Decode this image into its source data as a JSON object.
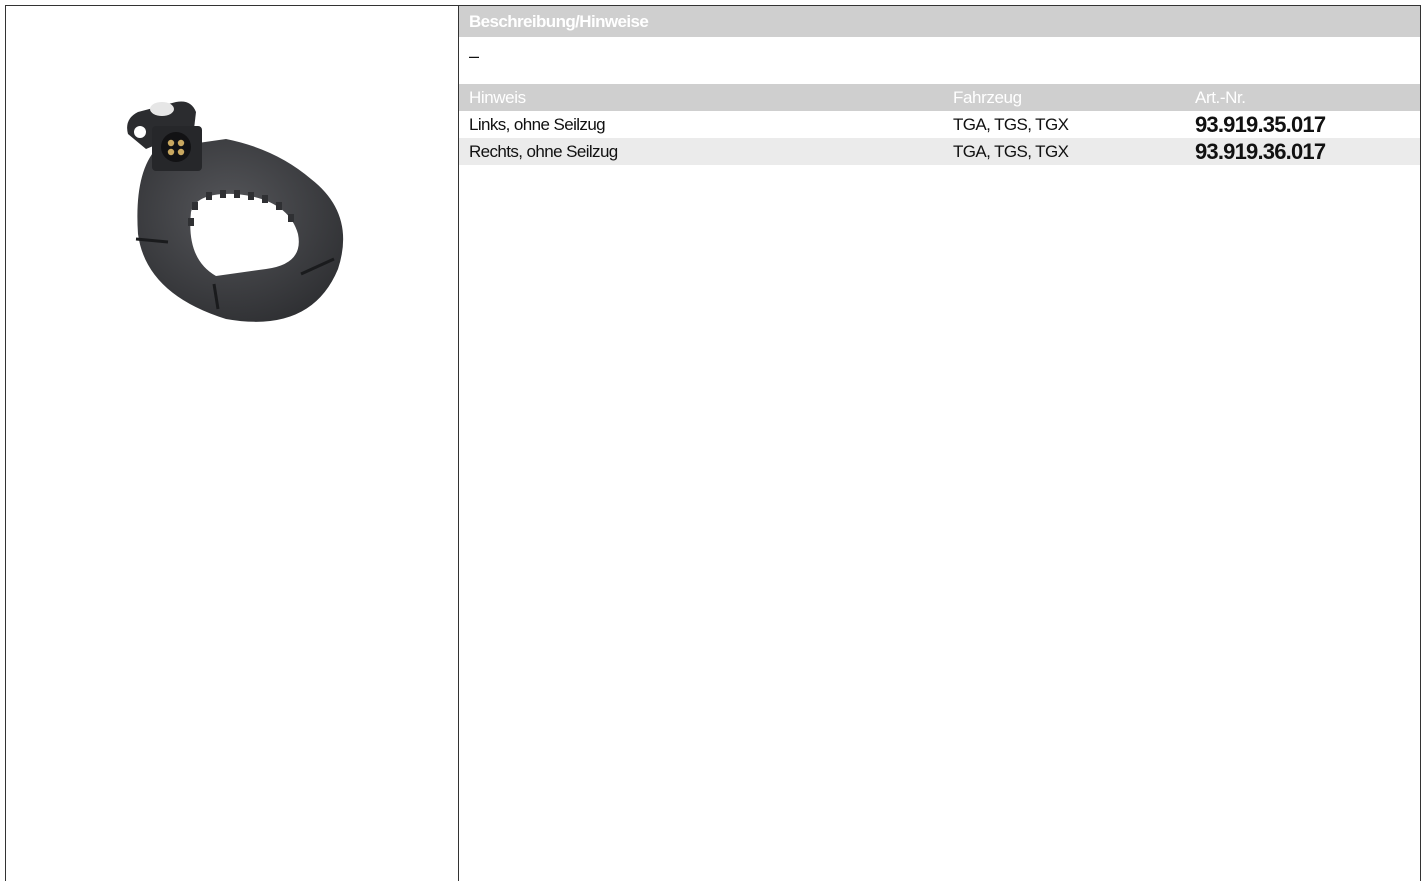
{
  "description": {
    "header": "Beschreibung/Hinweise",
    "text": "–"
  },
  "table": {
    "headers": {
      "note": "Hinweis",
      "vehicle": "Fahrzeug",
      "part_number": "Art.-Nr."
    },
    "rows": [
      {
        "note": "Links, ohne Seilzug",
        "vehicle": "TGA, TGS, TGX",
        "part_number": "93.919.35.017"
      },
      {
        "note": "Rechts, ohne Seilzug",
        "vehicle": "TGA, TGS, TGX",
        "part_number": "93.919.36.017"
      }
    ]
  },
  "colors": {
    "header_bg": "#cfcfcf",
    "header_text": "#ffffff",
    "row_alt_bg": "#ebebeb",
    "part_color": "#3a3b3e"
  },
  "icons": [
    "product-photo"
  ]
}
